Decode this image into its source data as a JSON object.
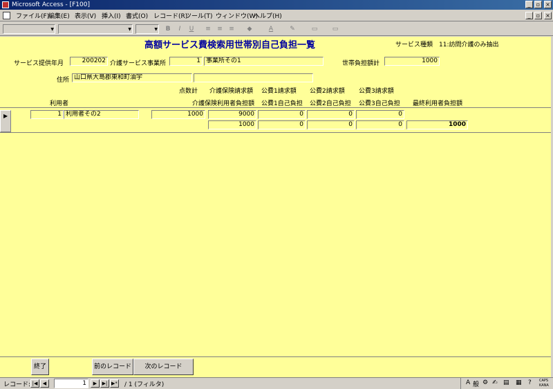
{
  "window": {
    "title": "Microsoft Access - [F100]"
  },
  "menu": {
    "items": [
      "ファイル(F)",
      "編集(E)",
      "表示(V)",
      "挿入(I)",
      "書式(O)",
      "レコード(R)",
      "ツール(T)",
      "ウィンドウ(W)",
      "ヘルプ(H)"
    ]
  },
  "form": {
    "title": "高額サービス費検索用世帯別自己負担一覧",
    "service_type_label": "サービス種類",
    "service_type_value": "11:訪問介護のみ抽出",
    "service_month_label": "サービス提供年月",
    "service_month_value": "200202",
    "provider_label": "介護サービス事業所",
    "provider_code": "1",
    "provider_name": "事業所その1",
    "household_total_label": "世帯負担額計",
    "household_total_value": "1000",
    "address_label": "住所",
    "address_value": "山口県大島郡東和町油宇",
    "address_value2": "",
    "columns": {
      "user": "利用者",
      "points": "点数計",
      "ins_claim": "介護保険請求額",
      "pub1_claim": "公費1請求額",
      "pub2_claim": "公費2請求額",
      "pub3_claim": "公費3請求額",
      "ins_burden": "介護保険利用者負担額",
      "pub1_burden": "公費1自己負担",
      "pub2_burden": "公費2自己負担",
      "pub3_burden": "公費3自己負担",
      "final_burden": "最終利用者負担額"
    },
    "record": {
      "user_id": "1",
      "user_name": "利用者その2",
      "points": "1000",
      "ins_claim": "9000",
      "pub1_claim": "0",
      "pub2_claim": "0",
      "pub3_claim": "0",
      "ins_burden": "1000",
      "pub1_burden": "0",
      "pub2_burden": "0",
      "pub3_burden": "0",
      "final_burden": "1000"
    }
  },
  "buttons": {
    "exit": "終了",
    "prev": "前のレコード",
    "next": "次のレコード"
  },
  "nav": {
    "label": "レコード:",
    "current": "1",
    "total_text": "/ 1 (フィルタ)"
  },
  "tray": {
    "caps": "CAPS",
    "kana": "KANA"
  }
}
